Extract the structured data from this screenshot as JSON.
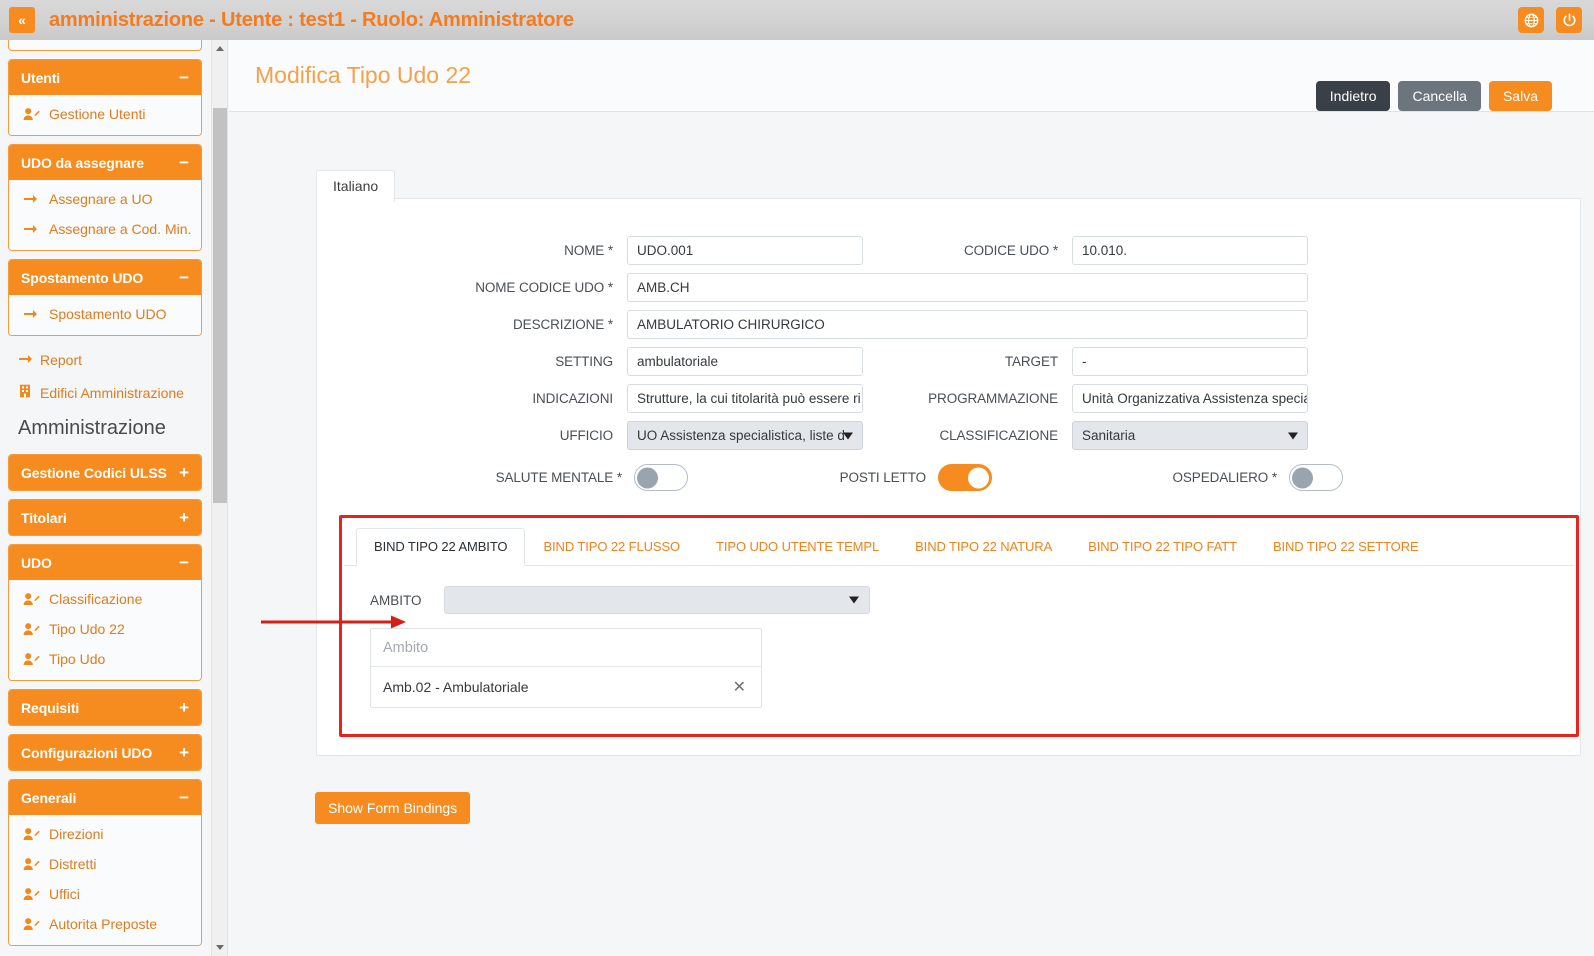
{
  "topbar": {
    "collapse_label": "«",
    "title": "amministrazione - Utente : test1 - Ruolo: Amministratore",
    "globe_icon": "globe-icon",
    "power_icon": "power-icon"
  },
  "sidebar": {
    "groups": [
      {
        "title": "Utenti",
        "toggle": "−",
        "items": [
          {
            "label": "Gestione Utenti",
            "icon": "user-edit-icon"
          }
        ]
      },
      {
        "title": "UDO da assegnare",
        "toggle": "−",
        "items": [
          {
            "label": "Assegnare a UO",
            "icon": "arrow-right-icon"
          },
          {
            "label": "Assegnare a Cod. Min.",
            "icon": "arrow-right-icon"
          }
        ]
      },
      {
        "title": "Spostamento UDO",
        "toggle": "−",
        "items": [
          {
            "label": "Spostamento UDO",
            "icon": "arrow-right-icon"
          }
        ]
      }
    ],
    "loose_items": [
      {
        "label": "Report",
        "icon": "arrow-right-icon"
      },
      {
        "label": "Edifici Amministrazione",
        "icon": "building-icon"
      }
    ],
    "section_heading": "Amministrazione",
    "groups2": [
      {
        "title": "Gestione Codici ULSS",
        "toggle": "+",
        "items": []
      },
      {
        "title": "Titolari",
        "toggle": "+",
        "items": []
      },
      {
        "title": "UDO",
        "toggle": "−",
        "items": [
          {
            "label": "Classificazione",
            "icon": "user-edit-icon"
          },
          {
            "label": "Tipo Udo 22",
            "icon": "user-edit-icon"
          },
          {
            "label": "Tipo Udo",
            "icon": "user-edit-icon"
          }
        ]
      },
      {
        "title": "Requisiti",
        "toggle": "+",
        "items": []
      },
      {
        "title": "Configurazioni UDO",
        "toggle": "+",
        "items": []
      },
      {
        "title": "Generali",
        "toggle": "−",
        "items": [
          {
            "label": "Direzioni",
            "icon": "user-edit-icon"
          },
          {
            "label": "Distretti",
            "icon": "user-edit-icon"
          },
          {
            "label": "Uffici",
            "icon": "user-edit-icon"
          },
          {
            "label": "Autorita Preposte",
            "icon": "user-edit-icon"
          }
        ]
      }
    ]
  },
  "page": {
    "title": "Modifica Tipo Udo 22",
    "actions": {
      "back": "Indietro",
      "cancel": "Cancella",
      "save": "Salva"
    }
  },
  "form": {
    "language_tab": "Italiano",
    "fields": {
      "nome": {
        "label": "NOME *",
        "value": "UDO.001"
      },
      "codice_udo": {
        "label": "CODICE UDO *",
        "value": "10.010."
      },
      "nome_codice_udo": {
        "label": "NOME CODICE UDO *",
        "value": "AMB.CH"
      },
      "descrizione": {
        "label": "DESCRIZIONE *",
        "value": "AMBULATORIO CHIRURGICO"
      },
      "setting": {
        "label": "SETTING",
        "value": "ambulatoriale"
      },
      "target": {
        "label": "TARGET",
        "value": "-"
      },
      "indicazioni": {
        "label": "INDICAZIONI",
        "value": "Strutture, la cui titolarità può essere ri"
      },
      "programmazione": {
        "label": "PROGRAMMAZIONE",
        "value": "Unità Organizzativa Assistenza specia"
      },
      "ufficio": {
        "label": "UFFICIO",
        "value": "UO Assistenza specialistica, liste d"
      },
      "classificazione": {
        "label": "CLASSIFICAZIONE",
        "value": "Sanitaria"
      }
    },
    "toggles": [
      {
        "label": "SALUTE MENTALE *",
        "state": "off"
      },
      {
        "label": "POSTI LETTO",
        "state": "on"
      },
      {
        "label": "OSPEDALIERO *",
        "state": "off"
      }
    ]
  },
  "bind": {
    "tabs": [
      {
        "label": "BIND TIPO 22 AMBITO",
        "active": true
      },
      {
        "label": "BIND TIPO 22 FLUSSO",
        "active": false
      },
      {
        "label": "TIPO UDO UTENTE TEMPL",
        "active": false
      },
      {
        "label": "BIND TIPO 22 NATURA",
        "active": false
      },
      {
        "label": "BIND TIPO 22 TIPO FATT",
        "active": false
      },
      {
        "label": "BIND TIPO 22 SETTORE",
        "active": false
      }
    ],
    "ambito_label": "AMBITO",
    "ambito_value": "",
    "filter_placeholder": "Ambito",
    "items": [
      {
        "label": "Amb.02 - Ambulatoriale",
        "remove_icon": "close-icon"
      }
    ]
  },
  "footer": {
    "show_bindings": "Show Form Bindings"
  },
  "colors": {
    "brand_orange": "#f68b1f",
    "title_orange": "#f47b20",
    "highlight_red": "#e8221c",
    "dark_button": "#3a4048",
    "gray_button": "#6c757d",
    "page_bg": "#f5f6f8"
  }
}
